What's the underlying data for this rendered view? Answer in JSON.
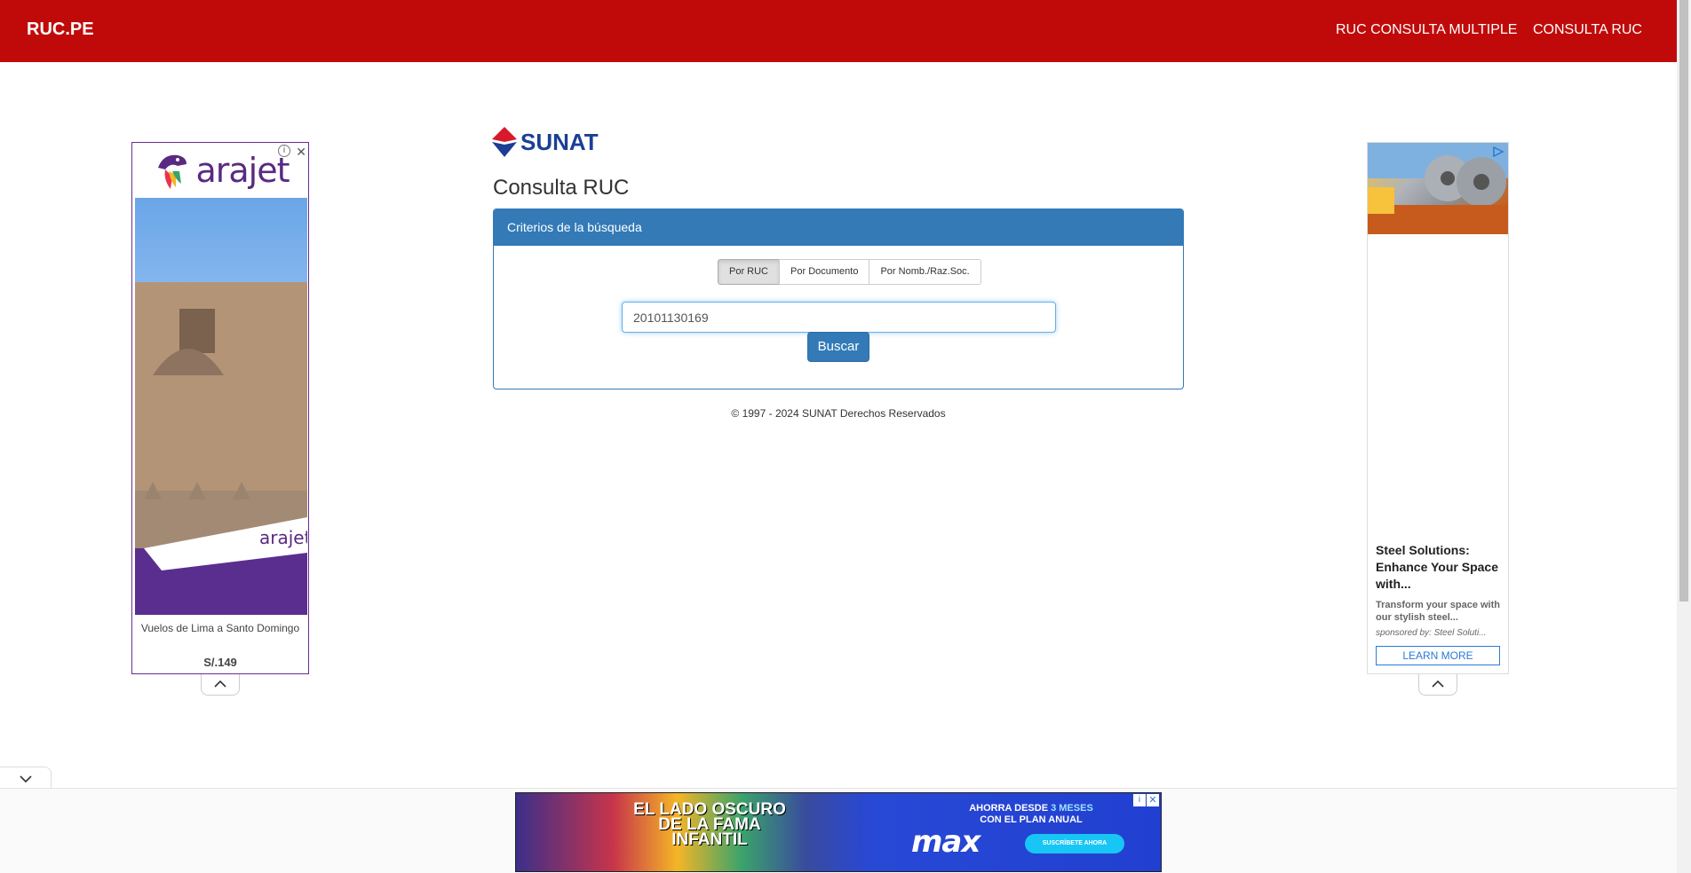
{
  "navbar": {
    "brand": "RUC.PE",
    "links": [
      "RUC CONSULTA MULTIPLE",
      "CONSULTA RUC"
    ]
  },
  "main": {
    "logo_text": "SUNAT",
    "title": "Consulta RUC",
    "panel_heading": "Criterios de la búsqueda",
    "search_tabs": [
      "Por RUC",
      "Por Documento",
      "Por Nomb./Raz.Soc."
    ],
    "active_tab": "Por RUC",
    "ruc_value": "20101130169",
    "search_button": "Buscar",
    "footer": "© 1997 - 2024 SUNAT Derechos Reservados"
  },
  "ad_left": {
    "brand": "arajet",
    "caption": "Vuelos de Lima a Santo Domingo",
    "price": "S/.149",
    "close_glyph": "✕",
    "info_glyph": "i"
  },
  "ad_right": {
    "headline": "Steel Solutions: Enhance Your Space with...",
    "description": "Transform your space with our stylish steel...",
    "sponsor": "sponsored by: Steel Soluti...",
    "cta": "LEARN MORE"
  },
  "ad_bottom": {
    "left_text": "EL LADO OSCURO DE LA FAMA INFANTIL",
    "promo_line1": "AHORRA DESDE",
    "promo_highlight": "3 MESES",
    "promo_line2": "CON EL PLAN ANUAL",
    "brand": "max",
    "cta": "SUSCRÍBETE AHORA"
  },
  "icons": {
    "chevron_up": "chevron-up-icon",
    "chevron_down": "chevron-down-icon",
    "close": "close-icon",
    "info": "info-icon",
    "adchoices": "adchoices-icon"
  },
  "colors": {
    "navbar": "#c00a0a",
    "primary": "#337ab7",
    "sunat_blue": "#1b3f95",
    "sunat_red": "#d7192b"
  }
}
